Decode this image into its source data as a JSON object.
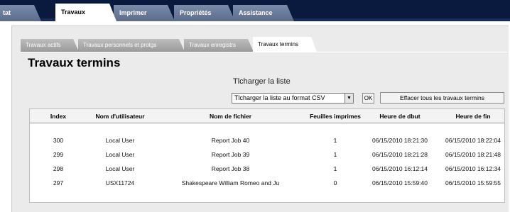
{
  "top_nav": {
    "tabs": [
      {
        "label": "tat",
        "active": false
      },
      {
        "label": "Travaux",
        "active": true
      },
      {
        "label": "Imprimer",
        "active": false
      },
      {
        "label": "Propriétés",
        "active": false
      },
      {
        "label": "Assistance",
        "active": false
      }
    ]
  },
  "sub_nav": {
    "tabs": [
      {
        "label": "Travaux actifs",
        "active": false
      },
      {
        "label": "Travaux personnels et protgs",
        "active": false
      },
      {
        "label": "Travaux enregistrs",
        "active": false
      },
      {
        "label": "Travaux termins",
        "active": true
      }
    ]
  },
  "page": {
    "title": "Travaux termins"
  },
  "download": {
    "label": "Tlcharger la liste",
    "select_value": "Tlcharger la liste au format CSV",
    "ok_label": "OK",
    "clear_label": "Effacer tous les travaux termins"
  },
  "table": {
    "headers": [
      "Index",
      "Nom d'utilisateur",
      "Nom de fichier",
      "Feuilles imprimes",
      "Heure de dbut",
      "Heure de fin"
    ],
    "rows": [
      [
        "300",
        "Local User",
        "Report Job 40",
        "1",
        "06/15/2010 18:21:30",
        "06/15/2010 18:22:04"
      ],
      [
        "299",
        "Local User",
        "Report Job 39",
        "1",
        "06/15/2010 18:21:28",
        "06/15/2010 18:21:48"
      ],
      [
        "298",
        "Local User",
        "Report Job 38",
        "1",
        "06/15/2010 16:12:14",
        "06/15/2010 16:12:34"
      ],
      [
        "297",
        "USX11724",
        "Shakespeare William Romeo and Ju",
        "0",
        "06/15/2010 15:59:40",
        "06/15/2010 15:59:55"
      ]
    ]
  }
}
